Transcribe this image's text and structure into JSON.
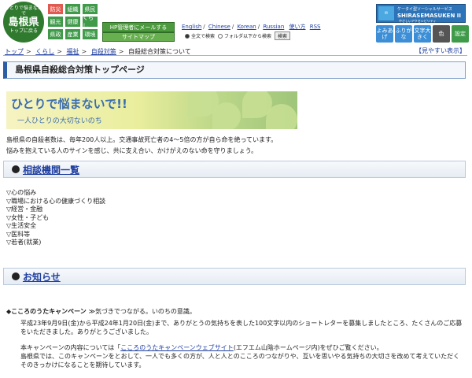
{
  "header": {
    "logo": {
      "line1": "ひとりで悩まないで",
      "line2": "島根県",
      "line3": "トップに戻る"
    },
    "categories": [
      {
        "label": "防災",
        "color": "#e05a4f"
      },
      {
        "label": "組織",
        "color": "#3f9b49"
      },
      {
        "label": "県民",
        "color": "#3f9b49"
      },
      {
        "label": "観光",
        "color": "#3f9b49"
      },
      {
        "label": "健康",
        "color": "#3f9b49"
      },
      {
        "label": "くらし",
        "color": "#3f9b49"
      },
      {
        "label": "県政",
        "color": "#3f9b49"
      },
      {
        "label": "産業",
        "color": "#3f9b49"
      },
      {
        "label": "環境",
        "color": "#3f9b49"
      }
    ],
    "hp_mail_label": "HP管理者にメールする",
    "sitemap_label": "サイトマップ",
    "languages": [
      "English",
      "Chinese",
      "Korean",
      "Russian"
    ],
    "usage_label": "使い方",
    "rss_label": "RSS",
    "search": {
      "option_all": "全文で検索",
      "option_folder": "フォルダ以下から検索",
      "button_label": "検索"
    },
    "banner": {
      "line1": "ケータイ型ソーシャルサービス",
      "line2": "SHIRASEMASUKEN II",
      "line3": "やさしいアクセシビリティ"
    },
    "tools": [
      {
        "label": "よみあげ",
        "color": "#3c8fd6"
      },
      {
        "label": "ふりがな",
        "color": "#3c8fd6"
      },
      {
        "label": "文字大きく",
        "color": "#3c8fd6"
      },
      {
        "label": "色",
        "color": "#555555"
      },
      {
        "label": "設定",
        "color": "#3f9b49"
      }
    ],
    "breadcrumb": [
      "トップ",
      "くらし",
      "福祉",
      "自殺対策",
      "自殺総合対策について"
    ],
    "help_link": "【見やすい表示】"
  },
  "main": {
    "page_title": "島根県自殺総合対策トップページ",
    "banner_main": "ひとりで悩まないで!!",
    "banner_sub": "一人ひとりの大切ないのち",
    "intro_line1": "島根県の自殺者数は、毎年200人以上。交通事故死亡者の4～5倍の方が自ら命を絶っています。",
    "intro_line2": "悩みを抱えている人のサインを感じ、共に支え合い、かけがえのない命を守りましょう。",
    "section_consult": "相談機関一覧",
    "consult_items": [
      "▽心の悩み",
      "▽職場における心の健康づくり相談",
      "▽経営・金融",
      "▽女性・子ども",
      "▽生活安全",
      "▽医科等",
      "▽若者(就業)"
    ],
    "section_news": "お知らせ",
    "campaign_title": "◆こころのうたキャンペーン",
    "campaign_slogan": "≫気づきでつながる。いのちの意識。",
    "campaign_p1": "平成23年9月9日(金)から平成24年1月20日(金)まで、ありがとうの気持ちを表した100文字以内のショートレターを募集しましたところ、たくさんのご応募をいただきました。ありがとうございました。",
    "campaign_p2_pre": "本キャンペーンの内容については「",
    "campaign_p2_link": "こころのうたキャンペーンウェブサイト",
    "campaign_p2_post": "(エフエム山陰ホームページ内)をぜひご覧ください。",
    "campaign_p3": "島根県では、このキャンペーンをとおして、一人でも多くの方が、人と人とのこころのつながりや、互いを思いやる気持ちの大切さを改めて考えていただく",
    "campaign_p4": "そのきっかけになることを期待しています。"
  }
}
